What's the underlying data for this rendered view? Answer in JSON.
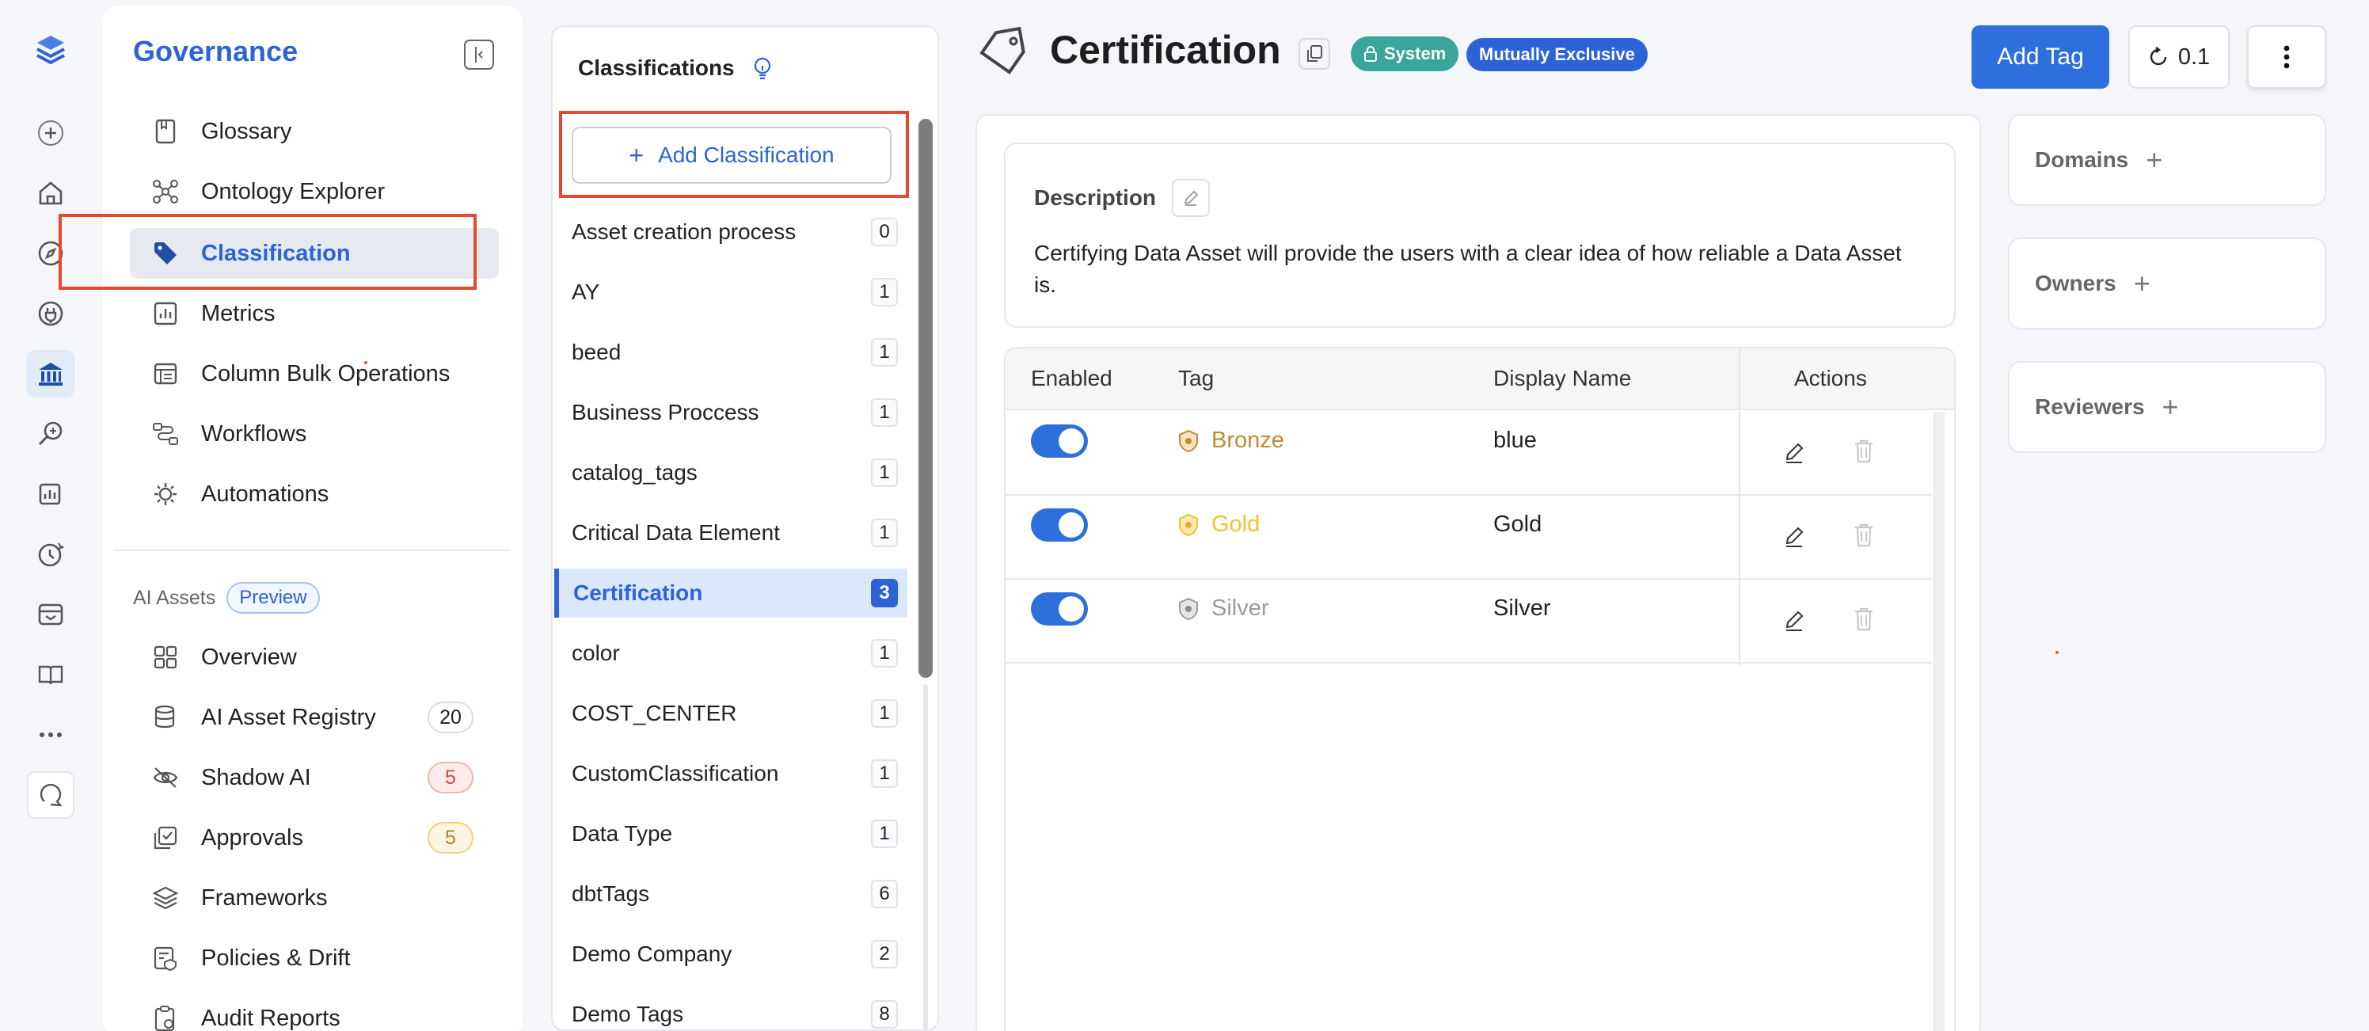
{
  "nav": {
    "title": "Governance",
    "items": [
      {
        "label": "Glossary"
      },
      {
        "label": "Ontology Explorer"
      },
      {
        "label": "Classification"
      },
      {
        "label": "Metrics"
      },
      {
        "label": "Column Bulk Operations"
      },
      {
        "label": "Workflows"
      },
      {
        "label": "Automations"
      }
    ],
    "ai_section": {
      "label": "AI Assets",
      "badge": "Preview",
      "items": [
        {
          "label": "Overview",
          "count": ""
        },
        {
          "label": "AI Asset Registry",
          "count": "20"
        },
        {
          "label": "Shadow AI",
          "count": "5"
        },
        {
          "label": "Approvals",
          "count": "5"
        },
        {
          "label": "Frameworks",
          "count": ""
        },
        {
          "label": "Policies & Drift",
          "count": ""
        },
        {
          "label": "Audit Reports",
          "count": ""
        }
      ]
    }
  },
  "classifications": {
    "title": "Classifications",
    "add_label": "Add Classification",
    "items": [
      {
        "name": "Asset creation process",
        "count": "0"
      },
      {
        "name": "AY",
        "count": "1"
      },
      {
        "name": "beed",
        "count": "1"
      },
      {
        "name": "Business Proccess",
        "count": "1"
      },
      {
        "name": "catalog_tags",
        "count": "1"
      },
      {
        "name": "Critical Data Element",
        "count": "1"
      },
      {
        "name": "Certification",
        "count": "3"
      },
      {
        "name": "color",
        "count": "1"
      },
      {
        "name": "COST_CENTER",
        "count": "1"
      },
      {
        "name": "CustomClassification",
        "count": "1"
      },
      {
        "name": "Data Type",
        "count": "1"
      },
      {
        "name": "dbtTags",
        "count": "6"
      },
      {
        "name": "Demo Company",
        "count": "2"
      },
      {
        "name": "Demo Tags",
        "count": "8"
      }
    ]
  },
  "header": {
    "title": "Certification",
    "badge_system": "System",
    "badge_mutual": "Mutually Exclusive",
    "add_tag": "Add Tag",
    "version": "0.1"
  },
  "description": {
    "label": "Description",
    "text": "Certifying Data Asset will provide the users with a clear idea of how reliable a Data Asset is."
  },
  "table": {
    "headers": {
      "enabled": "Enabled",
      "tag": "Tag",
      "display_name": "Display Name",
      "actions": "Actions"
    },
    "rows": [
      {
        "tag": "Bronze",
        "display": "blue",
        "enabled": true,
        "color": "#c58a2e"
      },
      {
        "tag": "Gold",
        "display": "Gold",
        "enabled": true,
        "color": "#f2c12e"
      },
      {
        "tag": "Silver",
        "display": "Silver",
        "enabled": true,
        "color": "#9b9b9b"
      }
    ]
  },
  "side": {
    "domains": "Domains",
    "owners": "Owners",
    "reviewers": "Reviewers"
  }
}
